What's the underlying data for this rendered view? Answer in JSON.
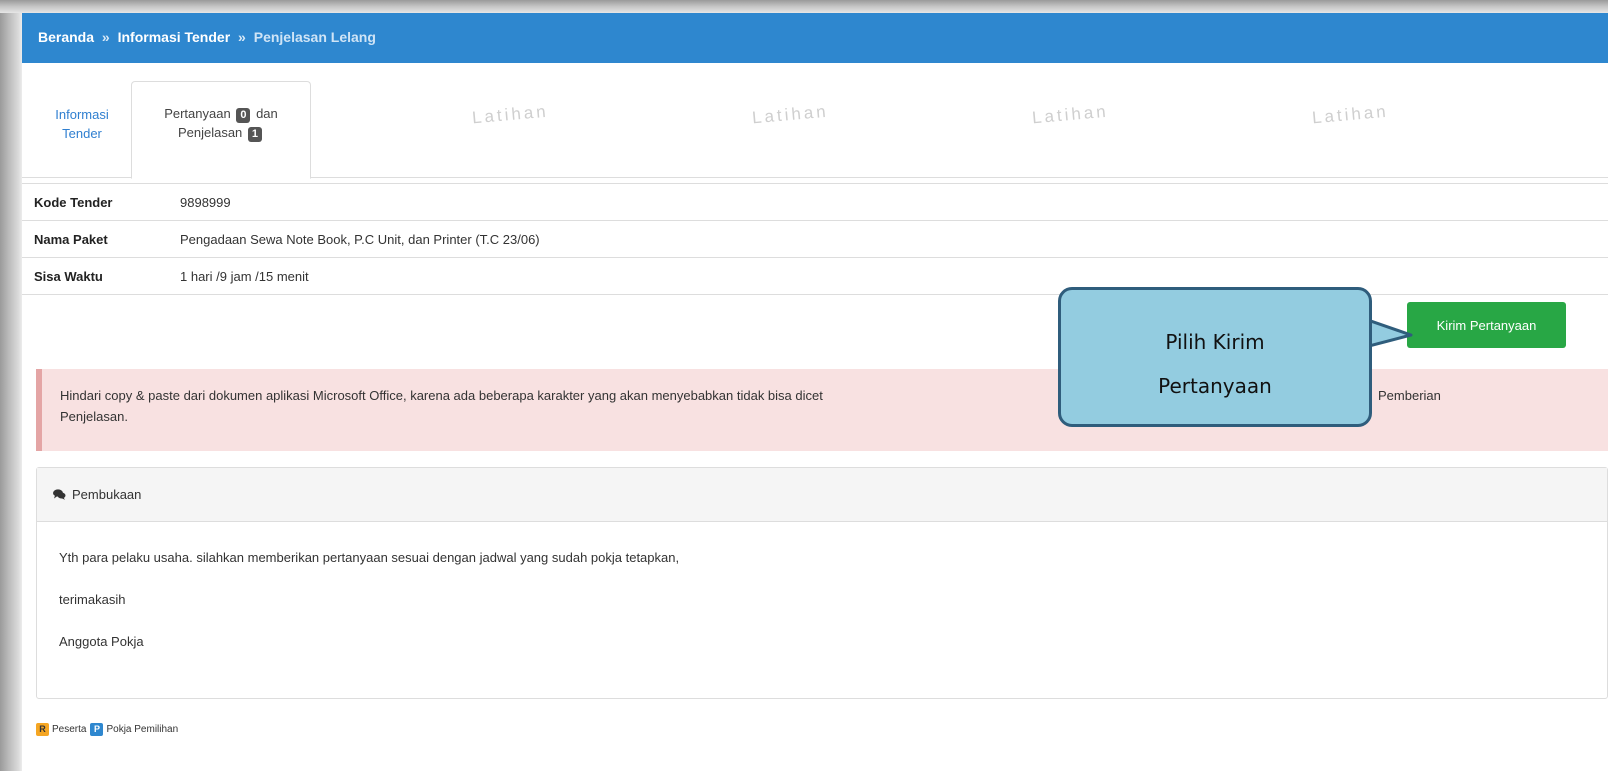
{
  "breadcrumb": {
    "home": "Beranda",
    "separator": "»",
    "info": "Informasi Tender",
    "current": "Penjelasan Lelang"
  },
  "tabs": {
    "info_line1": "Informasi",
    "info_line2": "Tender",
    "tanya_part1": "Pertanyaan",
    "tanya_badge": "0",
    "tanya_part2": "dan",
    "tanya_part3": "Penjelasan",
    "penjelasan_badge": "1"
  },
  "watermark": "Latihan",
  "details": {
    "kode_label": "Kode Tender",
    "kode_value": "9898999",
    "nama_label": "Nama Paket",
    "nama_value": "Pengadaan Sewa Note Book, P.C Unit, dan Printer (T.C 23/06)",
    "sisa_label": "Sisa Waktu",
    "sisa_value": "1 hari /9 jam /15 menit"
  },
  "kirim_button": "Kirim Pertanyaan",
  "alert": {
    "text_line1": "Hindari copy & paste dari dokumen aplikasi Microsoft Office, karena ada beberapa karakter yang akan menyebabkan tidak bisa dicet",
    "text_tail": "Pemberian",
    "text_line2": "Penjelasan."
  },
  "panel": {
    "title": "Pembukaan",
    "lines": [
      "Yth para pelaku usaha. silahkan memberikan pertanyaan sesuai dengan jadwal yang sudah pokja tetapkan,",
      "terimakasih",
      "Anggota Pokja"
    ]
  },
  "legend": {
    "r_badge": "R",
    "r_label": "Peserta",
    "p_badge": "P",
    "p_label": "Pokja Pemilihan"
  },
  "callout": {
    "line1": "Pilih Kirim",
    "line2": "Pertanyaan"
  },
  "colors": {
    "topbar": "#2e87cf",
    "button": "#28a745",
    "alert_bg": "#f8e1e1",
    "callout_bg": "#93cce0",
    "callout_border": "#2f5d7c"
  }
}
